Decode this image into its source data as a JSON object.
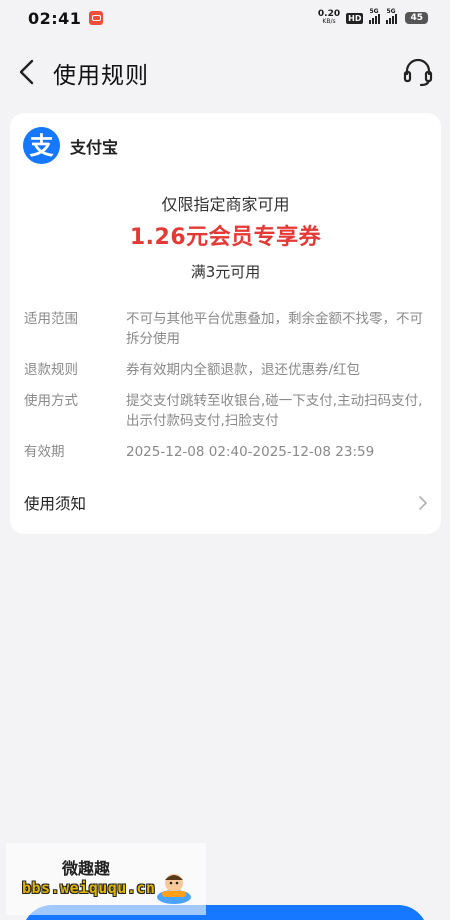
{
  "status_bar": {
    "time": "02:41",
    "net_speed_value": "0.20",
    "net_speed_unit": "KB/s",
    "hd_label": "HD",
    "signal1_label": "5G",
    "signal2_label": "5G",
    "battery": "45"
  },
  "header": {
    "title": "使用规则"
  },
  "card": {
    "brand_name": "支付宝",
    "brand_logo_glyph": "支",
    "scope": "仅限指定商家可用",
    "coupon_title": "1.26元会员专享券",
    "threshold": "满3元可用",
    "rules": [
      {
        "label": "适用范围",
        "value": "不可与其他平台优惠叠加，剩余金额不找零，不可拆分使用"
      },
      {
        "label": "退款规则",
        "value": "券有效期内全额退款，退还优惠券/红包"
      },
      {
        "label": "使用方式",
        "value": "提交支付跳转至收银台,碰一下支付,主动扫码支付,出示付款码支付,扫脸支付"
      },
      {
        "label": "有效期",
        "value": "2025-12-08 02:40-2025-12-08 23:59"
      }
    ],
    "notice_label": "使用须知"
  },
  "watermark": {
    "title": "微趣趣",
    "url": "bbs.weiququ.cn"
  },
  "colors": {
    "accent": "#1677ff",
    "coupon_red": "#e53935",
    "background": "#f3f3f5"
  },
  "icons": {
    "back": "chevron-left-icon",
    "support": "headset-icon",
    "notice": "chevron-right-icon"
  }
}
